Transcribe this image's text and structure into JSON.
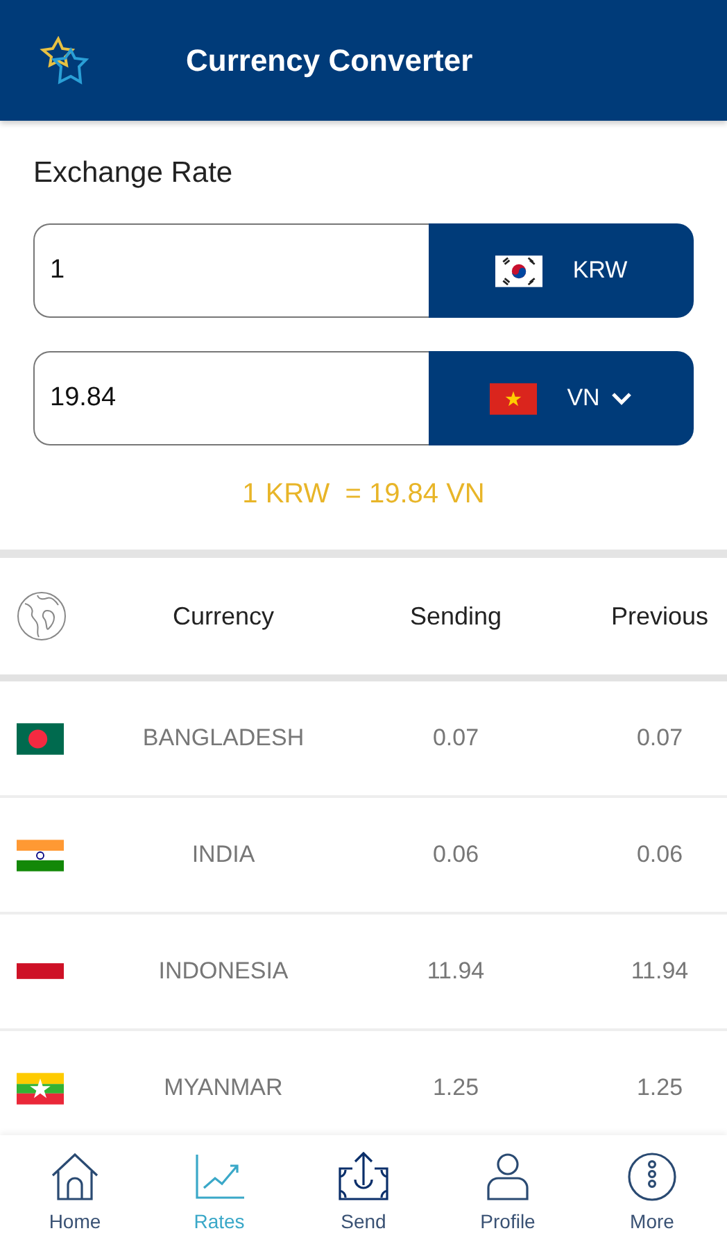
{
  "app_bar": {
    "title": "Currency Converter"
  },
  "converter": {
    "heading": "Exchange Rate",
    "fields": [
      {
        "value": "1",
        "currency": "KRW",
        "kind": "kr",
        "dropdown": false
      },
      {
        "value": "19.84",
        "currency": "VN",
        "kind": "vn",
        "dropdown": true
      }
    ],
    "result": "1 KRW  = 19.84 VN"
  },
  "table": {
    "columns": [
      "Currency",
      "Sending",
      "Previous"
    ],
    "rows": [
      {
        "kind": "bd",
        "country": "BANGLADESH",
        "sending": "0.07",
        "previous": "0.07"
      },
      {
        "kind": "in",
        "country": "INDIA",
        "sending": "0.06",
        "previous": "0.06"
      },
      {
        "kind": "id",
        "country": "INDONESIA",
        "sending": "11.94",
        "previous": "11.94"
      },
      {
        "kind": "mm",
        "country": "MYANMAR",
        "sending": "1.25",
        "previous": "1.25"
      }
    ]
  },
  "bottom_nav": [
    {
      "kind": "home",
      "label": "Home",
      "selected": false
    },
    {
      "kind": "chart",
      "label": "Rates",
      "selected": true
    },
    {
      "kind": "send",
      "label": "Send",
      "selected": false
    },
    {
      "kind": "profile",
      "label": "Profile",
      "selected": false
    },
    {
      "kind": "more",
      "label": "More",
      "selected": false
    }
  ]
}
